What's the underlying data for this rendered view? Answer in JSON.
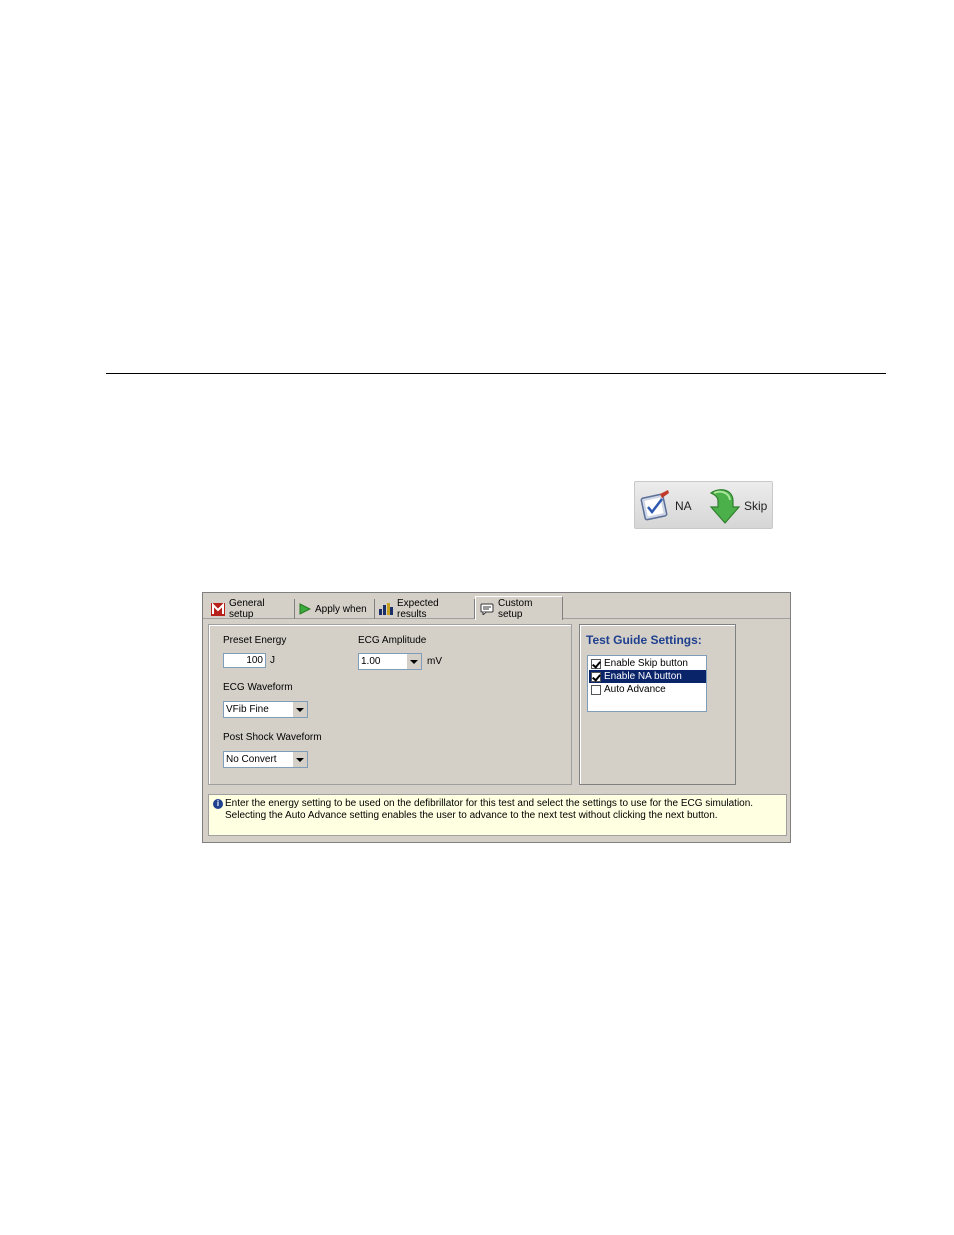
{
  "toolbar": {
    "na_label": "NA",
    "skip_label": "Skip"
  },
  "tabs": [
    {
      "label": "General setup",
      "icon": "m-logo-icon"
    },
    {
      "label": "Apply when",
      "icon": "play-arrow-icon"
    },
    {
      "label": "Expected results",
      "icon": "bar-chart-icon"
    },
    {
      "label": "Custom setup",
      "icon": "chat-bubble-icon",
      "active": true
    }
  ],
  "form": {
    "preset_energy_label": "Preset Energy",
    "preset_energy_value": "100",
    "preset_energy_unit": "J",
    "ecg_amplitude_label": "ECG Amplitude",
    "ecg_amplitude_value": "1.00",
    "ecg_amplitude_unit": "mV",
    "ecg_waveform_label": "ECG Waveform",
    "ecg_waveform_value": "VFib Fine",
    "post_shock_label": "Post Shock Waveform",
    "post_shock_value": "No Convert"
  },
  "test_guide": {
    "title": "Test Guide Settings:",
    "items": [
      {
        "label": "Enable Skip button",
        "checked": true
      },
      {
        "label": "Enable NA button",
        "checked": true,
        "selected": true
      },
      {
        "label": "Auto Advance",
        "checked": false
      }
    ]
  },
  "info": {
    "line1": "Enter the energy setting to be used on the defibrillator for this test and select the settings to use for the ECG simulation.",
    "line2": "Selecting the Auto Advance setting enables the user to advance to the next test without clicking the next button."
  },
  "colors": {
    "dialog_bg": "#d4d0c8",
    "title_blue": "#1f3f8f",
    "selection": "#0a246a",
    "info_bg": "#ffffe1"
  }
}
